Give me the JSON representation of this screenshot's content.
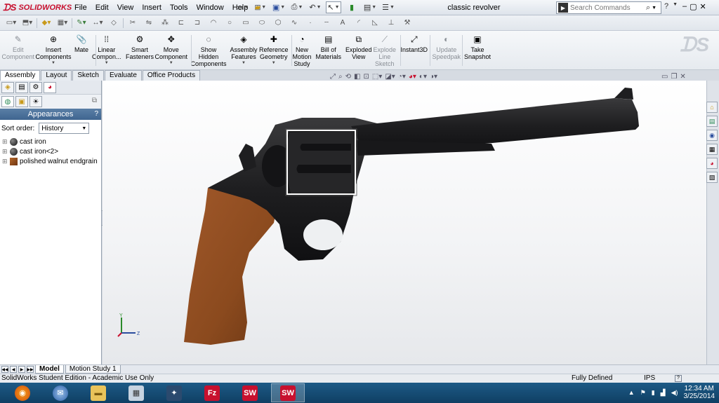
{
  "app": {
    "logo_text": "SOLIDWORKS",
    "document_title": "classic revolver"
  },
  "menu": [
    "File",
    "Edit",
    "View",
    "Insert",
    "Tools",
    "Window",
    "Help"
  ],
  "search": {
    "placeholder": "Search Commands"
  },
  "commands": [
    {
      "label": "Edit\nComponent",
      "dim": true
    },
    {
      "label": "Insert\nComponents",
      "dim": false,
      "dropdown": true
    },
    {
      "label": "Mate",
      "dim": false
    },
    {
      "label": "Linear\nCompon...",
      "dim": false,
      "dropdown": true
    },
    {
      "label": "Smart\nFasteners",
      "dim": false
    },
    {
      "label": "Move\nComponent",
      "dim": false,
      "dropdown": true
    },
    {
      "label": "Show\nHidden\nComponents",
      "dim": false
    },
    {
      "label": "Assembly\nFeatures",
      "dim": false,
      "dropdown": true
    },
    {
      "label": "Reference\nGeometry",
      "dim": false,
      "dropdown": true
    },
    {
      "label": "New\nMotion\nStudy",
      "dim": false
    },
    {
      "label": "Bill of\nMaterials",
      "dim": false
    },
    {
      "label": "Exploded\nView",
      "dim": false
    },
    {
      "label": "Explode\nLine\nSketch",
      "dim": true
    },
    {
      "label": "Instant3D",
      "dim": false
    },
    {
      "label": "Update\nSpeedpak",
      "dim": true
    },
    {
      "label": "Take\nSnapshot",
      "dim": false
    }
  ],
  "tabs": [
    "Assembly",
    "Layout",
    "Sketch",
    "Evaluate",
    "Office Products"
  ],
  "active_tab": "Assembly",
  "panel": {
    "header": "Appearances",
    "help": "?",
    "sort_label": "Sort order:",
    "sort_value": "History",
    "items": [
      {
        "label": "cast iron",
        "icon": "cast-iron-sphere-icon"
      },
      {
        "label": "cast iron<2>",
        "icon": "cast-iron-sphere-icon"
      },
      {
        "label": "polished walnut endgrain",
        "icon": "walnut-texture-icon"
      }
    ]
  },
  "triad": {
    "y": "Y",
    "z": "Z"
  },
  "bottom_tabs": [
    "Model",
    "Motion Study 1"
  ],
  "status": {
    "left": "SolidWorks Student Edition - Academic Use Only",
    "state": "Fully Defined",
    "units": "IPS",
    "help": "?"
  },
  "clock": {
    "time": "12:34 AM",
    "date": "3/25/2014"
  },
  "colors": {
    "grip": "#8b4a1e",
    "steel": "#2a2a2a",
    "accent": "#c8102e",
    "taskbar": "#1d5a86"
  }
}
